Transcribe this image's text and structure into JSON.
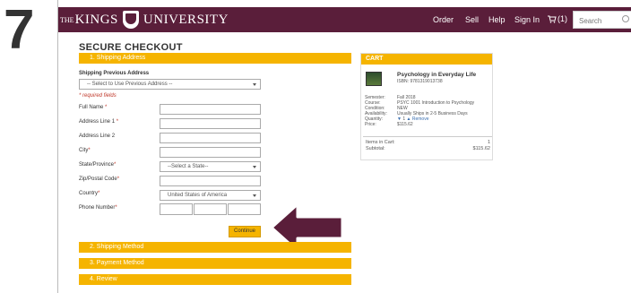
{
  "step_number": "7",
  "header": {
    "logo": {
      "the": "THE",
      "kings": "KINGS",
      "university": "UNIVERSITY"
    },
    "nav": {
      "order": "Order",
      "sell": "Sell",
      "help": "Help",
      "sign_in": "Sign In",
      "cart_count": "(1)"
    },
    "search": {
      "placeholder": "Search"
    },
    "brand_color": "#5a1e3a"
  },
  "checkout": {
    "title": "SECURE CHECKOUT",
    "sections": {
      "shipping_address": "1. Shipping Address",
      "shipping_method": "2. Shipping Method",
      "payment_method": "3. Payment Method",
      "review": "4. Review"
    },
    "accent_color": "#f5b400",
    "previous_address_label": "Shipping Previous Address",
    "previous_address_select": "-- Select to Use Previous Address --",
    "required_note": "* required fields",
    "fields": {
      "full_name": "Full Name",
      "address1": "Address Line 1",
      "address2": "Address Line 2",
      "city": "City",
      "state": "State/Province",
      "zip": "Zip/Postal Code",
      "country": "Country",
      "phone": "Phone Number"
    },
    "required_mark": "*",
    "state_select": "--Select a State--",
    "country_select": "United States of America",
    "continue_label": "Continue"
  },
  "cart": {
    "title": "CART",
    "item": {
      "title": "Psychology in Everyday Life",
      "isbn": "ISBN: 9781319013738",
      "labels": [
        "Semester:",
        "Course:",
        "Condition:",
        "Availability:",
        "Quantity:",
        "Price:"
      ],
      "semester": "Fall 2018",
      "course": "PSYC 1001 Introduction to Psychology",
      "condition": "NEW",
      "availability": "Usually Ships in 2-5 Business Days",
      "quantity_down": "▼",
      "quantity": "1",
      "quantity_up": "▲",
      "remove": "Remove",
      "price": "$115.62"
    },
    "items_in_cart_label": "Items in Cart:",
    "items_in_cart_value": "1",
    "subtotal_label": "Subtotal:",
    "subtotal_value": "$115.62"
  }
}
